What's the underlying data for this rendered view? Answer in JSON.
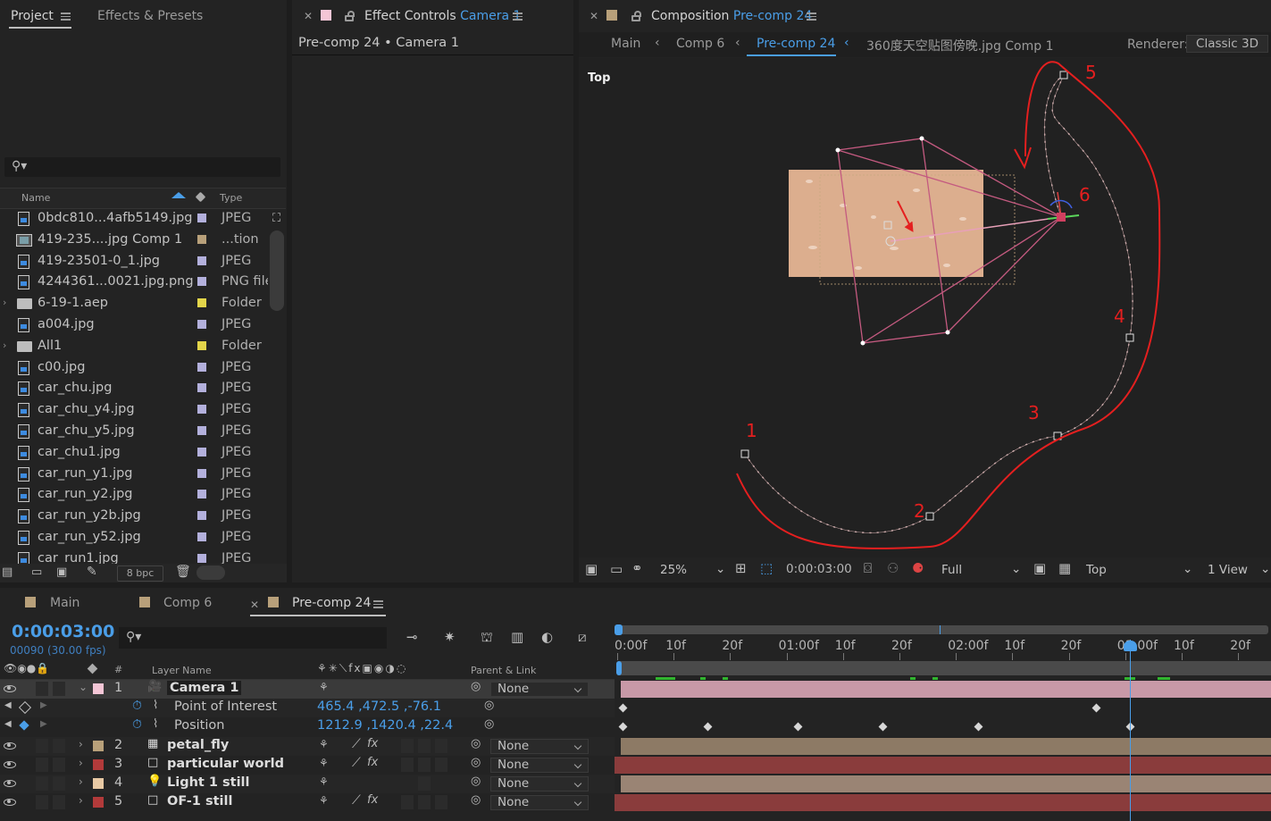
{
  "project_panel": {
    "tabs": [
      {
        "label": "Project"
      },
      {
        "label": "Effects & Presets"
      }
    ],
    "columns": {
      "name": "Name",
      "type": "Type"
    },
    "items": [
      {
        "name": "0bdc810...4afb5149.jpg",
        "type": "JPEG",
        "kind": "image",
        "label_color": "#b3b0dc"
      },
      {
        "name": "419-235....jpg Comp 1",
        "type": "...tion",
        "kind": "comp",
        "label_color": "#b8a07a"
      },
      {
        "name": "419-23501-0_1.jpg",
        "type": "JPEG",
        "kind": "image",
        "label_color": "#b3b0dc"
      },
      {
        "name": "4244361...0021.jpg.png",
        "type": "PNG file",
        "kind": "image",
        "label_color": "#b3b0dc"
      },
      {
        "name": "6-19-1.aep",
        "type": "Folder",
        "kind": "folder",
        "label_color": "#e3d54a"
      },
      {
        "name": "a004.jpg",
        "type": "JPEG",
        "kind": "image",
        "label_color": "#b3b0dc"
      },
      {
        "name": "All1",
        "type": "Folder",
        "kind": "folder",
        "label_color": "#e3d54a"
      },
      {
        "name": "c00.jpg",
        "type": "JPEG",
        "kind": "image",
        "label_color": "#b3b0dc"
      },
      {
        "name": "car_chu.jpg",
        "type": "JPEG",
        "kind": "image",
        "label_color": "#b3b0dc"
      },
      {
        "name": "car_chu_y4.jpg",
        "type": "JPEG",
        "kind": "image",
        "label_color": "#b3b0dc"
      },
      {
        "name": "car_chu_y5.jpg",
        "type": "JPEG",
        "kind": "image",
        "label_color": "#b3b0dc"
      },
      {
        "name": "car_chu1.jpg",
        "type": "JPEG",
        "kind": "image",
        "label_color": "#b3b0dc"
      },
      {
        "name": "car_run_y1.jpg",
        "type": "JPEG",
        "kind": "image",
        "label_color": "#b3b0dc"
      },
      {
        "name": "car_run_y2.jpg",
        "type": "JPEG",
        "kind": "image",
        "label_color": "#b3b0dc"
      },
      {
        "name": "car_run_y2b.jpg",
        "type": "JPEG",
        "kind": "image",
        "label_color": "#b3b0dc"
      },
      {
        "name": "car_run_y52.jpg",
        "type": "JPEG",
        "kind": "image",
        "label_color": "#b3b0dc"
      },
      {
        "name": "car_run1.jpg",
        "type": "JPEG",
        "kind": "image",
        "label_color": "#b3b0dc"
      }
    ],
    "bit_depth": "8 bpc"
  },
  "effect_controls": {
    "tab_prefix": "Effect Controls",
    "tab_target": "Camera 1",
    "subtitle": "Pre-comp 24 • Camera 1"
  },
  "composition": {
    "tab_prefix": "Composition",
    "tab_target": "Pre-comp 24",
    "breadcrumbs": [
      {
        "label": "Main"
      },
      {
        "label": "Comp 6"
      },
      {
        "label": "Pre-comp 24"
      },
      {
        "label": "360度天空贴图傍晚.jpg Comp 1"
      }
    ],
    "renderer_label": "Renderer:",
    "renderer_value": "Classic 3D",
    "view_name": "Top",
    "annotations": [
      "1",
      "2",
      "3",
      "4",
      "5",
      "6"
    ],
    "footer": {
      "zoom": "25%",
      "timecode": "0:00:03:00",
      "resolution": "Full",
      "view": "Top",
      "layout": "1 View"
    }
  },
  "timeline": {
    "tabs": [
      {
        "label": "Main"
      },
      {
        "label": "Comp 6"
      },
      {
        "label": "Pre-comp 24"
      }
    ],
    "timecode": "0:00:03:00",
    "frame_info": "00090 (30.00 fps)",
    "headers": {
      "hash": "#",
      "layer_name": "Layer Name",
      "parent": "Parent & Link"
    },
    "ruler": [
      "0:00f",
      "10f",
      "20f",
      "01:00f",
      "10f",
      "20f",
      "02:00f",
      "10f",
      "20f",
      "03:00f",
      "10f",
      "20f"
    ],
    "layers": [
      {
        "num": "1",
        "name": "Camera 1",
        "parent": "None",
        "color": "#f4c6d6",
        "bar": "#c899a7"
      },
      {
        "num": "2",
        "name": "petal_fly",
        "parent": "None",
        "color": "#b8a07a",
        "bar": "#8d7a65"
      },
      {
        "num": "3",
        "name": "particular world",
        "parent": "None",
        "color": "#b23a3a",
        "bar": "#8a3c3c"
      },
      {
        "num": "4",
        "name": "Light 1 still",
        "parent": "None",
        "color": "#e8c9a4",
        "bar": "#9a8474"
      },
      {
        "num": "5",
        "name": "OF-1 still",
        "parent": "None",
        "color": "#b23a3a",
        "bar": "#8a3c3c"
      }
    ],
    "properties": [
      {
        "name": "Point of Interest",
        "value": "465.4 ,472.5 ,-76.1"
      },
      {
        "name": "Position",
        "value": "1212.9 ,1420.4 ,22.4"
      }
    ]
  }
}
